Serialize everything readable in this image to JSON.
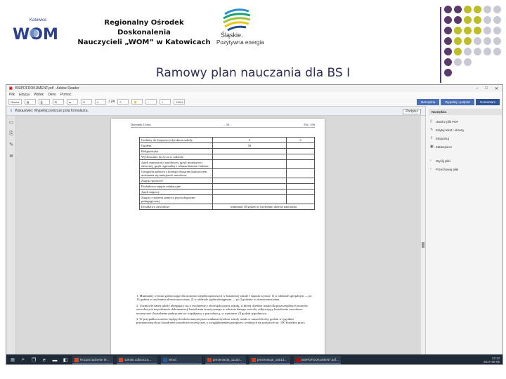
{
  "header": {
    "wom_logo_text": "Katowice",
    "wom_logo_mark": "WOM",
    "org_line1": "Regionalny Ośrodek Doskonalenia",
    "org_line2": "Nauczycieli „WOM” w Katowicach",
    "region_name": "Śląskie.",
    "region_tagline": "Pozytywna energia"
  },
  "slide_title": "Ramowy plan nauczania dla BS I",
  "colors": {
    "title": "#2b2b55",
    "dot_purple": "#5a3a6a",
    "dot_olive": "#bdbd2a",
    "dot_grey": "#c9c9d6",
    "accent_blue": "#4a6fb5"
  },
  "viewer": {
    "window_title": "BSIPDFDOKUMENT.pdf - Adobe Reader",
    "menu": [
      "Plik",
      "Edycja",
      "Widok",
      "Okno",
      "Pomoc"
    ],
    "toolbar": {
      "open_label": "Otwórz",
      "page_current": "4",
      "page_total": "/ 24",
      "zoom": "139%",
      "tab_tools": "Narzędzia",
      "tab_fill_sign": "Wypełnij i podpisz",
      "tab_comment": "Komentarz"
    },
    "doc_notice": "Wskazówki: Wypełnij poniższe pola formularza.",
    "sign_button": "Podpisz",
    "page": {
      "head_left": "Dziennik Ustaw",
      "head_center": "– 30 –",
      "head_right": "Poz. 356",
      "rows": [
        {
          "label": "Godziny do dyspozycji dyrektora szkoły",
          "v1": "3",
          "v2": "3"
        },
        {
          "label": "Ogółem",
          "v1": "59",
          "v2": ""
        },
        {
          "label": "Religia/etyka",
          "v1": "",
          "v2": ""
        },
        {
          "label": "Wychowanie do życia w rodzinie",
          "v1": "",
          "v2": ""
        },
        {
          "label": "Język mniejszości narodowej, język mniejszości etnicznej, język regionalny i własna historia i kultura",
          "v1": "",
          "v2": ""
        },
        {
          "label": "Geografia państwa z którego obszarem kulturowym utożsamia się mniejszość narodowa",
          "v1": "",
          "v2": ""
        },
        {
          "label": "Zajęcia sportowe",
          "v1": "",
          "v2": ""
        },
        {
          "label": "Dodatkowe zajęcia edukacyjne",
          "v1": "",
          "v2": ""
        },
        {
          "label": "Język migowy",
          "v1": "",
          "v2": ""
        },
        {
          "label": "Zajęcia z zakresu pomocy psychologiczno-pedagogicznej",
          "v1": "",
          "v2": ""
        },
        {
          "label": "Doradztwo zawodowe",
          "v1": "minimum 10 godzin w trzyletnim okresie nauczania",
          "v2": ""
        }
      ],
      "notes": [
        "1. Minimalny wymiar godzin zajęć dla uczniów niepełnosprawnych w branżowej szkole I stopnia wynosi: 1) w oddziale specjalnym — po 13 godzin w trzyletnim okresie nauczania; 2) w oddziale ogólnodostępnym — po 2 godziny w okresie nauczania.",
        "2. Uczniowie danej szkoły ubiegający się o zwolnienie z obowiązku przez szkołę, w której dyrektor ustala dla poszczególnych uczniów zawodowych na podstawie dokumentacji kształcenia teoretycznego w zakresie danego zawodu, odbywający kształcenie zawodowe teoretyczne i kształcenie praktyczne we współpracy z pracodawcą, w wymiarze 24 godzin tygodniowo.",
        "3. W przypadku uczniów będących młodocianymi pracownikami dyrektor szkoły ustala w ramach liczby godzin w tygodniu przeznaczonych na kształcenie zawodowe teoretyczne, z uwzględnieniem przepisów wydanych na podstawie art. 190 Kodeksu pracy."
      ]
    },
    "right_panel": {
      "head": "Narzędzia",
      "items": [
        "Utwórz plik PDF",
        "Edytuj tekst i obrazy",
        "Eksportuj",
        "Zabezpiecz",
        "Wyślij pliki",
        "Przechowuj pliki"
      ]
    },
    "taskbar": {
      "apps": [
        "Rozporządzenie M...",
        "Szkoła odbiorcza...",
        "Word",
        "prezentacja_11120...",
        "prezentacja_16013...",
        "BSIPDFDOKUMENT.pdf..."
      ],
      "time": "13:13",
      "date": "2017-06-05"
    }
  }
}
